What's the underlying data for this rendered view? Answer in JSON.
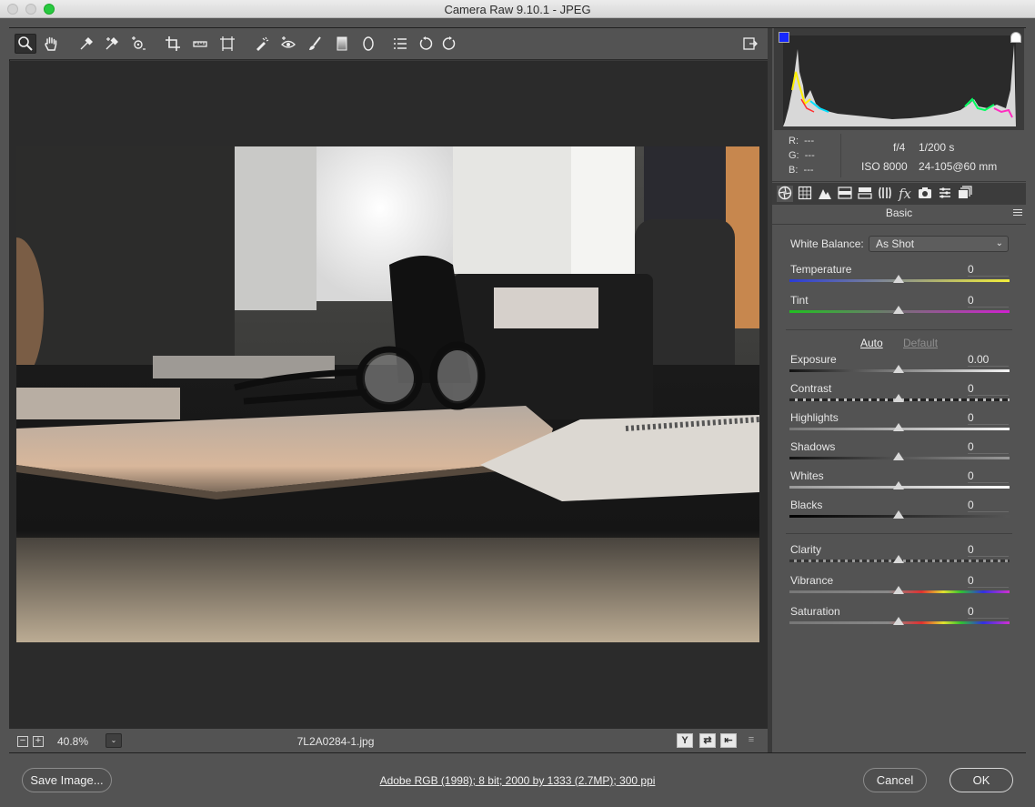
{
  "window": {
    "title": "Camera Raw 9.10.1  -  JPEG"
  },
  "toolbar": {
    "tools": [
      "zoom-tool-icon",
      "hand-tool-icon",
      "white-balance-tool-icon",
      "color-sampler-tool-icon",
      "targeted-adjustment-tool-icon",
      "crop-tool-icon",
      "straighten-tool-icon",
      "transform-tool-icon",
      "spot-removal-tool-icon",
      "red-eye-removal-tool-icon",
      "adjustment-brush-icon",
      "graduated-filter-icon",
      "radial-filter-icon",
      "preferences-icon",
      "rotate-left-icon",
      "rotate-right-icon"
    ],
    "toggle_fullscreen": "fullscreen-toggle-icon"
  },
  "preview": {
    "zoom_minus": "−",
    "zoom_plus": "+",
    "zoom_value": "40.8%",
    "zoom_dropdown": "⌄",
    "filename": "7L2A0284-1.jpg",
    "view_buttons": [
      "Y",
      "⇄",
      "⇤",
      "≡"
    ]
  },
  "info": {
    "r_label": "R:",
    "r_value": "---",
    "g_label": "G:",
    "g_value": "---",
    "b_label": "B:",
    "b_value": "---",
    "aperture": "f/4",
    "shutter": "1/200 s",
    "iso": "ISO 8000",
    "lens": "24-105@60 mm"
  },
  "panel": {
    "section_title": "Basic",
    "white_balance_label": "White Balance:",
    "white_balance_value": "As Shot",
    "auto_label": "Auto",
    "default_label": "Default",
    "sliders": {
      "temperature": {
        "label": "Temperature",
        "value": "0"
      },
      "tint": {
        "label": "Tint",
        "value": "0"
      },
      "exposure": {
        "label": "Exposure",
        "value": "0.00"
      },
      "contrast": {
        "label": "Contrast",
        "value": "0"
      },
      "highlights": {
        "label": "Highlights",
        "value": "0"
      },
      "shadows": {
        "label": "Shadows",
        "value": "0"
      },
      "whites": {
        "label": "Whites",
        "value": "0"
      },
      "blacks": {
        "label": "Blacks",
        "value": "0"
      },
      "clarity": {
        "label": "Clarity",
        "value": "0"
      },
      "vibrance": {
        "label": "Vibrance",
        "value": "0"
      },
      "saturation": {
        "label": "Saturation",
        "value": "0"
      }
    }
  },
  "footer": {
    "save_image": "Save Image...",
    "workflow_options": "Adobe RGB (1998); 8 bit; 2000 by 1333 (2.7MP); 300 ppi",
    "cancel": "Cancel",
    "ok": "OK"
  },
  "colors": {
    "panel_bg": "#535353",
    "preview_bg": "#2b2b2b",
    "clip_shadow": "#1628ff",
    "max_button": "#28c940"
  }
}
